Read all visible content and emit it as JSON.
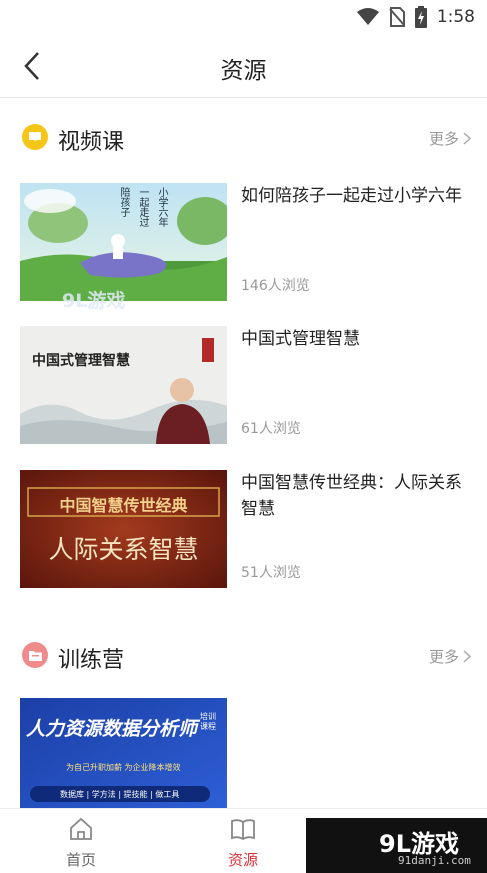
{
  "status_bar": {
    "time": "1:58"
  },
  "nav": {
    "title": "资源"
  },
  "video_section": {
    "title": "视频课",
    "more": "更多"
  },
  "courses": [
    {
      "title": "如何陪孩子一起走过小学六年",
      "views": "146人浏览",
      "cover_text": [
        "陪孩子",
        "一起走过",
        "小学六年"
      ]
    },
    {
      "title": "中国式管理智慧",
      "views": "61人浏览",
      "cover_text": [
        "中国式管理智慧"
      ]
    },
    {
      "title": "中国智慧传世经典：人际关系智慧",
      "views": "51人浏览",
      "cover_text": [
        "中国智慧传世经典",
        "人际关系智慧"
      ]
    }
  ],
  "camp_section": {
    "title": "训练营",
    "more": "更多"
  },
  "camp": {
    "cover_title": "人力资源数据分析师",
    "cover_badge": "培训课程",
    "cover_sub": "为自己升职加薪  为企业降本增效",
    "cover_tags": "数据库 | 学方法 | 提技能 | 做工具"
  },
  "tabs": [
    {
      "label": "首页"
    },
    {
      "label": "资源"
    }
  ],
  "watermark": {
    "logo": "9L游戏",
    "url": "91danji.com"
  },
  "colors": {
    "accent": "#e0303a",
    "video_icon": "#f5c518",
    "camp_icon": "#f08b8b"
  }
}
